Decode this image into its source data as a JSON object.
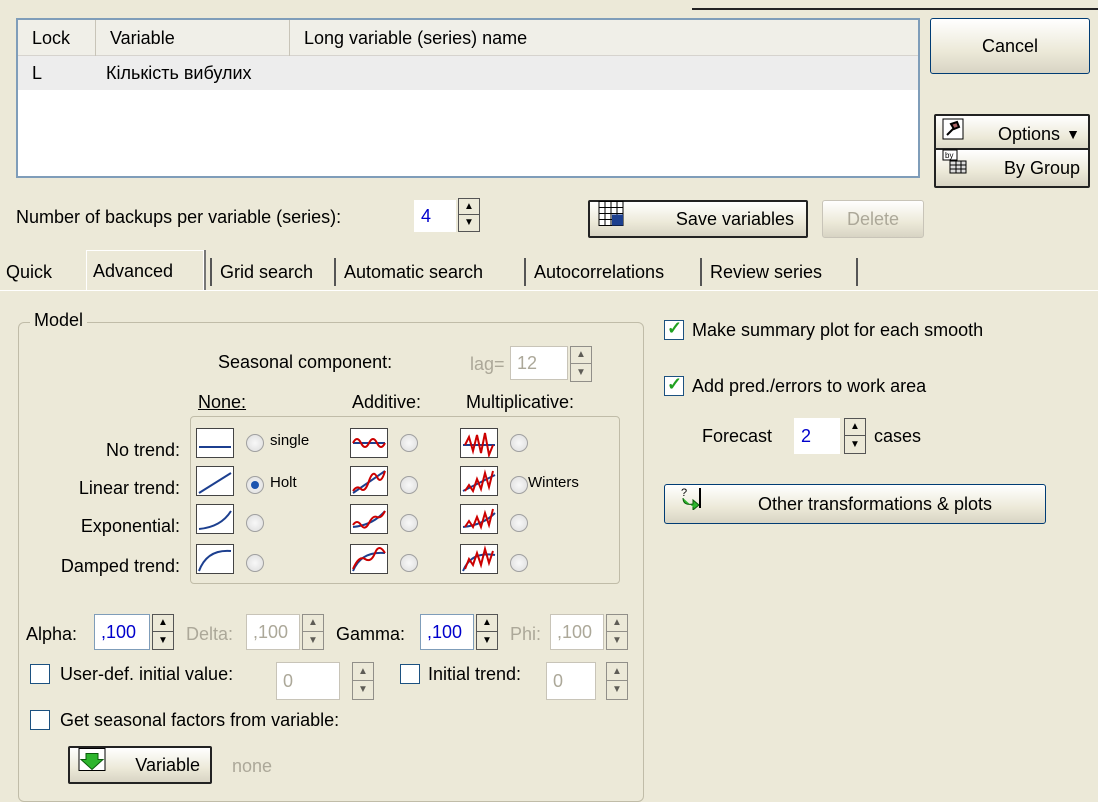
{
  "variable_list": {
    "columns": [
      "Lock",
      "Variable",
      "Long variable (series) name"
    ],
    "rows": [
      {
        "lock": "L",
        "variable": "Кількість вибулих",
        "long_name": ""
      }
    ]
  },
  "buttons": {
    "cancel": "Cancel",
    "options": "Options",
    "by_group": "By Group",
    "save_variables": "Save variables",
    "delete": "Delete",
    "other_transformations": "Other transformations & plots",
    "variable": "Variable"
  },
  "backups": {
    "label": "Number of backups per variable (series):",
    "value": "4"
  },
  "tabs": [
    "Quick",
    "Advanced",
    "Grid search",
    "Automatic search",
    "Autocorrelations",
    "Review series"
  ],
  "active_tab": "Advanced",
  "model": {
    "title": "Model",
    "seasonal_label": "Seasonal component:",
    "lag_label": "lag=",
    "lag_value": "12",
    "col_none": "None:",
    "col_additive": "Additive:",
    "col_multiplicative": "Multiplicative:",
    "rows": [
      "No trend:",
      "Linear trend:",
      "Exponential:",
      "Damped trend:"
    ],
    "single": "single",
    "holt": "Holt",
    "winters": "Winters",
    "selected": "Holt"
  },
  "params": {
    "alpha_label": "Alpha:",
    "alpha": ",100",
    "delta_label": "Delta:",
    "delta": ",100",
    "gamma_label": "Gamma:",
    "gamma": ",100",
    "phi_label": "Phi:",
    "phi": ",100"
  },
  "user_initial": {
    "label": "User-def. initial value:",
    "value": "0",
    "checked": false
  },
  "initial_trend": {
    "label": "Initial trend:",
    "value": "0",
    "checked": false
  },
  "seasonal_factors": {
    "label": "Get seasonal factors from variable:",
    "checked": false,
    "variable_value": "none"
  },
  "right_panel": {
    "summary_plot": {
      "label": "Make summary plot for each smooth",
      "checked": true
    },
    "add_pred": {
      "label": "Add pred./errors to work area",
      "checked": true
    },
    "forecast_label": "Forecast",
    "forecast_value": "2",
    "cases_label": "cases"
  }
}
